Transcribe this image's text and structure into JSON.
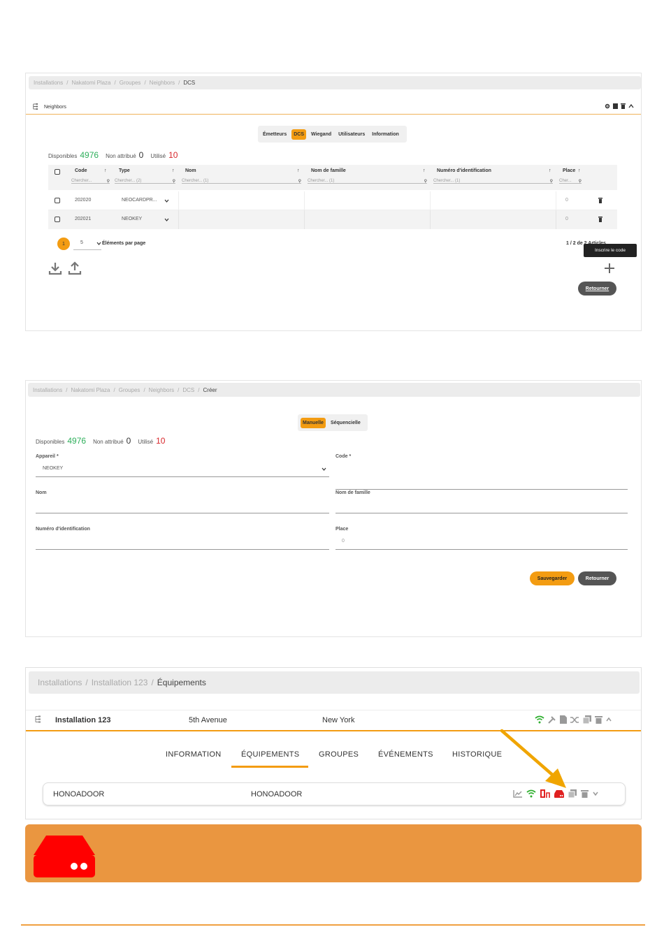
{
  "screen1": {
    "breadcrumb": [
      "Installations",
      "Nakatomi Plaza",
      "Groupes",
      "Neighbors",
      "DCS"
    ],
    "header_title": "Neighbors",
    "tabs": [
      "Émetteurs",
      "DCS",
      "Wiegand",
      "Utilisateurs",
      "Information"
    ],
    "active_tab": "DCS",
    "stats": {
      "available_label": "Disponibles",
      "available": "4976",
      "unassigned_label": "Non attribué",
      "unassigned": "0",
      "used_label": "Utilisé",
      "used": "10"
    },
    "columns": [
      "Code",
      "Type",
      "Nom",
      "Nom de famille",
      "Numéro d'identification",
      "Place"
    ],
    "search_placeholders": [
      "Chercher...",
      "Chercher... (2)",
      "Chercher... (1)",
      "Chercher... (1)",
      "Chercher... (1)",
      "Cher..."
    ],
    "rows": [
      {
        "code": "202020",
        "type": "NEOCARDPR...",
        "place": "0"
      },
      {
        "code": "202021",
        "type": "NEOKEY",
        "place": "0"
      }
    ],
    "pagination": {
      "page": "1",
      "per_page": "5",
      "per_page_label": "Éléments par page",
      "summary": "1 / 2 de 2 Articles"
    },
    "tooltip": "Inscrire le code",
    "back_button": "Retourner"
  },
  "screen2": {
    "breadcrumb": [
      "Installations",
      "Nakatomi Plaza",
      "Groupes",
      "Neighbors",
      "DCS",
      "Créer"
    ],
    "tabs": [
      "Manuelle",
      "Séquencielle"
    ],
    "active_tab": "Manuelle",
    "stats": {
      "available_label": "Disponibles",
      "available": "4976",
      "unassigned_label": "Non attribué",
      "unassigned": "0",
      "used_label": "Utilisé",
      "used": "10"
    },
    "fields": {
      "device_label": "Appareil *",
      "device_value": "NEOKEY",
      "code_label": "Code *",
      "name_label": "Nom",
      "lastname_label": "Nom de famille",
      "id_label": "Numéro d'identification",
      "place_label": "Place",
      "place_value": "0"
    },
    "save_button": "Sauvegarder",
    "back_button": "Retourner"
  },
  "screen3": {
    "breadcrumb": [
      "Installations",
      "Installation 123",
      "Équipements"
    ],
    "installation_name": "Installation 123",
    "address": "5th Avenue",
    "city": "New York",
    "tabs": [
      "INFORMATION",
      "ÉQUIPEMENTS",
      "GROUPES",
      "ÉVÉNEMENTS",
      "HISTORIQUE"
    ],
    "active_tab": "ÉQUIPEMENTS",
    "device": {
      "name": "HONOADOOR",
      "type": "HONOADOOR"
    }
  },
  "colors": {
    "accent": "#f39c12",
    "banner": "#ea9640",
    "green": "#2eaf5b",
    "red": "#d8262b",
    "arrow": "#f0a500",
    "device_icon": "#ff0000"
  }
}
